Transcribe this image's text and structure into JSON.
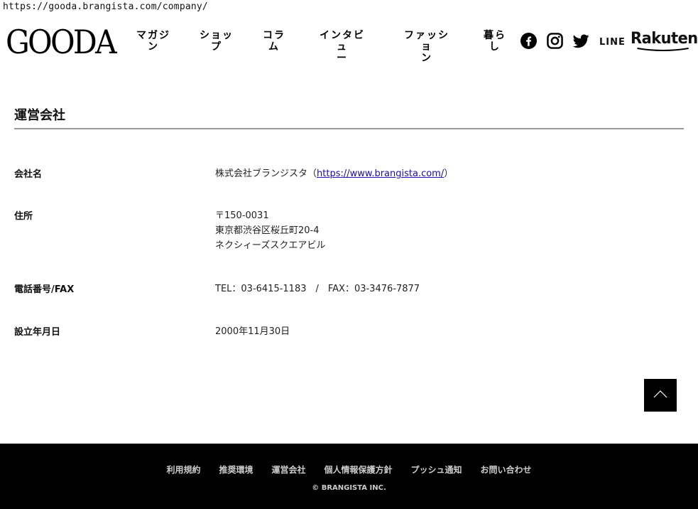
{
  "browser": {
    "url": "https://gooda.brangista.com/company/"
  },
  "header": {
    "logo": "GOODA",
    "nav": [
      {
        "line1": "マガジ",
        "line2": "ン"
      },
      {
        "line1": "ショッ",
        "line2": "プ"
      },
      {
        "line1": "コラ",
        "line2": "ム"
      },
      {
        "line1": "インタビュ",
        "line2": "ー"
      },
      {
        "line1": "ファッショ",
        "line2": "ン"
      },
      {
        "line1": "暮ら",
        "line2": "し"
      }
    ],
    "social": {
      "line": "LINE",
      "rakuten": "Rakuten"
    }
  },
  "main": {
    "title": "運営会社",
    "rows": [
      {
        "label": "会社名",
        "value_prefix": "株式会社ブランジスタ（",
        "link": "https://www.brangista.com/",
        "value_suffix": "）"
      },
      {
        "label": "住所",
        "lines": [
          "〒150-0031",
          "東京都渋谷区桜丘町20-4",
          "ネクシィーズスクエアビル"
        ]
      },
      {
        "label": "電話番号/FAX",
        "value": "TEL：03-6415-1183　/　FAX：03-3476-7877"
      },
      {
        "label": "設立年月日",
        "value": "2000年11月30日"
      }
    ]
  },
  "footer": {
    "links": [
      "利用規約",
      "推奨環境",
      "運営会社",
      "個人情報保護方針",
      "プッシュ通知",
      "お問い合わせ"
    ],
    "copyright": "© BRANGISTA INC."
  }
}
